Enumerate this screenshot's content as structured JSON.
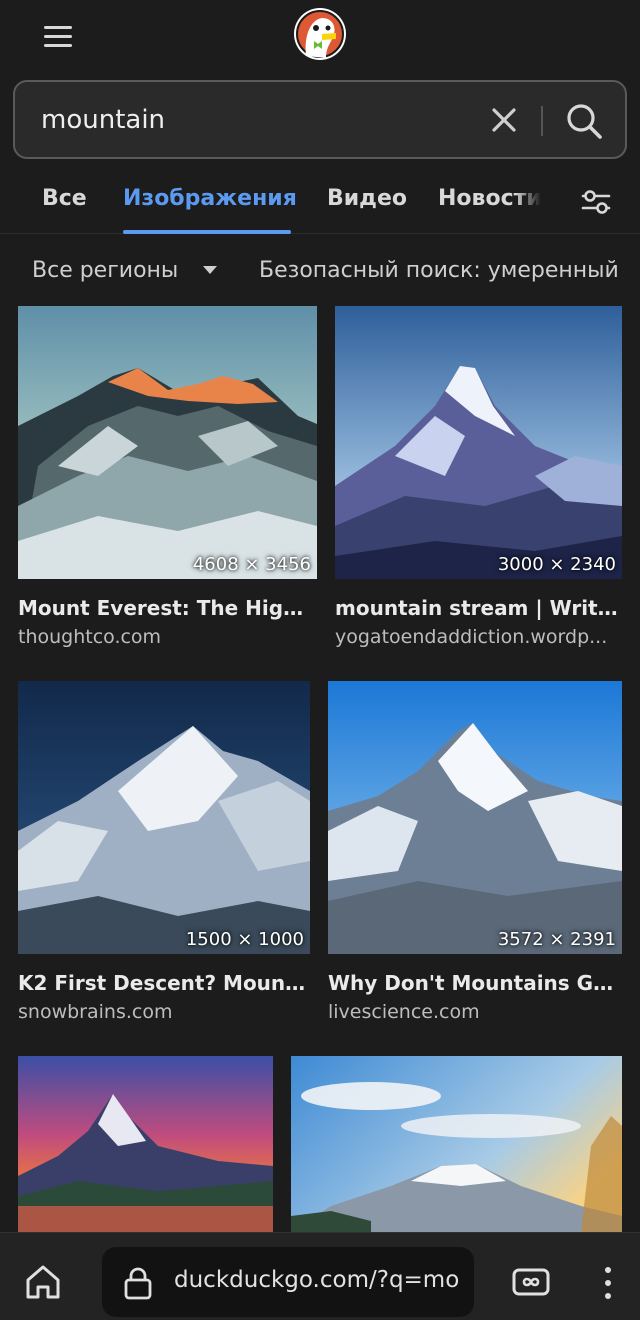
{
  "search": {
    "query": "mountain"
  },
  "tabs": [
    {
      "label": "Все"
    },
    {
      "label": "Изображения"
    },
    {
      "label": "Видео"
    },
    {
      "label": "Новости"
    }
  ],
  "filters": {
    "region": "Все регионы",
    "safe_search": "Безопасный поиск: умеренный"
  },
  "results": [
    {
      "title": "Mount Everest: The Highe...",
      "source": "thoughtco.com",
      "dimensions": "4608 × 3456"
    },
    {
      "title": "mountain stream | Writin...",
      "source": "yogatoendaddiction.wordp...",
      "dimensions": "3000 × 2340"
    },
    {
      "title": "K2 First Descent? Mount...",
      "source": "snowbrains.com",
      "dimensions": "1500 × 1000"
    },
    {
      "title": "Why Don't Mountains Gro...",
      "source": "livescience.com",
      "dimensions": "3572 × 2391"
    },
    {
      "title": "",
      "source": "",
      "dimensions": ""
    },
    {
      "title": "",
      "source": "",
      "dimensions": ""
    }
  ],
  "browser": {
    "url": "duckduckgo.com/?q=mo"
  },
  "icons": {
    "menu": "hamburger-menu-icon",
    "logo": "duckduckgo-logo",
    "clear": "close-icon",
    "search": "search-icon",
    "filters": "sliders-icon",
    "caret": "caret-down-icon",
    "home": "home-icon",
    "lock": "lock-icon",
    "tabs": "tab-switcher-icon",
    "more": "more-vertical-icon"
  },
  "colors": {
    "background": "#1c1c1c",
    "accent": "#5b9af0",
    "text": "#eeeeee",
    "muted_text": "#bdbdbd"
  }
}
